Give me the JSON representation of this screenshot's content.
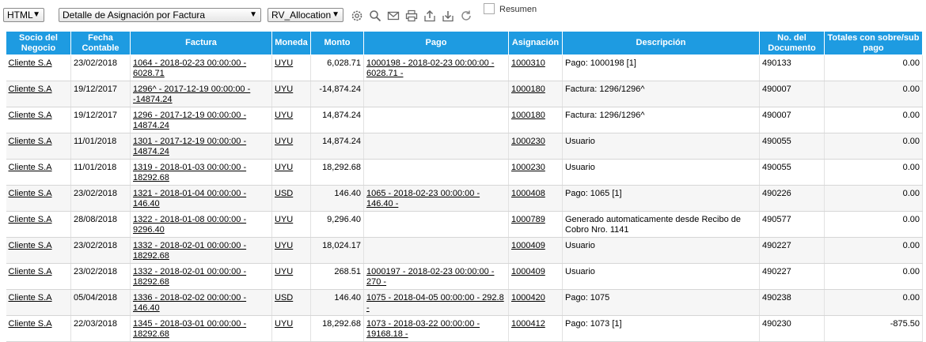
{
  "toolbar": {
    "format_select": "HTML",
    "report_select": "Detalle de Asignación por Factura",
    "view_select": "RV_Allocation",
    "resumen_label": "Resumen",
    "icons": [
      "settings-icon",
      "search-icon",
      "email-icon",
      "print-icon",
      "export-icon",
      "download-icon",
      "refresh-icon"
    ]
  },
  "table": {
    "headers": [
      "Socio del Negocio",
      "Fecha Contable",
      "Factura",
      "Moneda",
      "Monto",
      "Pago",
      "Asignación",
      "Descripción",
      "No. del Documento",
      "Totales con sobre/sub pago"
    ],
    "rows": [
      {
        "socio": "Cliente S.A",
        "fecha": "23/02/2018",
        "factura": "1064 - 2018-02-23 00:00:00 - 6028.71",
        "moneda": "UYU",
        "monto": "6,028.71",
        "pago": "1000198 - 2018-02-23 00:00:00 - 6028.71 -",
        "asignacion": "1000310",
        "descripcion": "Pago: 1000198 [1]",
        "documento": "490133",
        "totales": "0.00"
      },
      {
        "socio": "Cliente S.A",
        "fecha": "19/12/2017",
        "factura": "1296^ - 2017-12-19 00:00:00 - -14874.24",
        "moneda": "UYU",
        "monto": "-14,874.24",
        "pago": "",
        "asignacion": "1000180",
        "descripcion": "Factura: 1296/1296^",
        "documento": "490007",
        "totales": "0.00"
      },
      {
        "socio": "Cliente S.A",
        "fecha": "19/12/2017",
        "factura": "1296 - 2017-12-19 00:00:00 - 14874.24",
        "moneda": "UYU",
        "monto": "14,874.24",
        "pago": "",
        "asignacion": "1000180",
        "descripcion": "Factura: 1296/1296^",
        "documento": "490007",
        "totales": "0.00"
      },
      {
        "socio": "Cliente S.A",
        "fecha": "11/01/2018",
        "factura": "1301 - 2017-12-19 00:00:00 - 14874.24",
        "moneda": "UYU",
        "monto": "14,874.24",
        "pago": "",
        "asignacion": "1000230",
        "descripcion": "Usuario",
        "documento": "490055",
        "totales": "0.00"
      },
      {
        "socio": "Cliente S.A",
        "fecha": "11/01/2018",
        "factura": "1319 - 2018-01-03 00:00:00 - 18292.68",
        "moneda": "UYU",
        "monto": "18,292.68",
        "pago": "",
        "asignacion": "1000230",
        "descripcion": "Usuario",
        "documento": "490055",
        "totales": "0.00"
      },
      {
        "socio": "Cliente S.A",
        "fecha": "23/02/2018",
        "factura": "1321 - 2018-01-04 00:00:00 - 146.40",
        "moneda": "USD",
        "monto": "146.40",
        "pago": "1065 - 2018-02-23 00:00:00 - 146.40 -",
        "asignacion": "1000408",
        "descripcion": "Pago: 1065 [1]",
        "documento": "490226",
        "totales": "0.00"
      },
      {
        "socio": "Cliente S.A",
        "fecha": "28/08/2018",
        "factura": "1322 - 2018-01-08 00:00:00 - 9296.40",
        "moneda": "UYU",
        "monto": "9,296.40",
        "pago": "",
        "asignacion": "1000789",
        "descripcion": "Generado automaticamente desde Recibo de Cobro Nro. 1141",
        "documento": "490577",
        "totales": "0.00"
      },
      {
        "socio": "Cliente S.A",
        "fecha": "23/02/2018",
        "factura": "1332 - 2018-02-01 00:00:00 - 18292.68",
        "moneda": "UYU",
        "monto": "18,024.17",
        "pago": "",
        "asignacion": "1000409",
        "descripcion": "Usuario",
        "documento": "490227",
        "totales": "0.00"
      },
      {
        "socio": "Cliente S.A",
        "fecha": "23/02/2018",
        "factura": "1332 - 2018-02-01 00:00:00 - 18292.68",
        "moneda": "UYU",
        "monto": "268.51",
        "pago": "1000197 - 2018-02-23 00:00:00 - 270 -",
        "asignacion": "1000409",
        "descripcion": "Usuario",
        "documento": "490227",
        "totales": "0.00"
      },
      {
        "socio": "Cliente S.A",
        "fecha": "05/04/2018",
        "factura": "1336 - 2018-02-02 00:00:00 - 146.40",
        "moneda": "USD",
        "monto": "146.40",
        "pago": "1075 - 2018-04-05 00:00:00 - 292.8 -",
        "asignacion": "1000420",
        "descripcion": "Pago: 1075",
        "documento": "490238",
        "totales": "0.00"
      },
      {
        "socio": "Cliente S.A",
        "fecha": "22/03/2018",
        "factura": "1345 - 2018-03-01 00:00:00 - 18292.68",
        "moneda": "UYU",
        "monto": "18,292.68",
        "pago": "1073 - 2018-03-22 00:00:00 - 19168.18 -",
        "asignacion": "1000412",
        "descripcion": "Pago: 1073 [1]",
        "documento": "490230",
        "totales": "-875.50"
      }
    ]
  }
}
